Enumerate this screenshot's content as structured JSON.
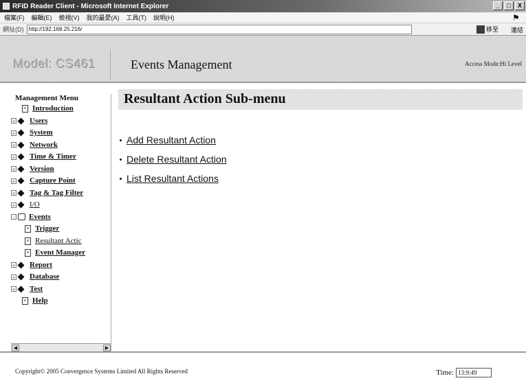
{
  "window": {
    "title": "RFID Reader Client - Microsoft Internet Explorer",
    "controls": [
      "_",
      "□",
      "X"
    ]
  },
  "menubar": {
    "items": [
      "檔案(F)",
      "編輯(E)",
      "檢視(V)",
      "我的最愛(A)",
      "工具(T)",
      "說明(H)"
    ]
  },
  "addressbar": {
    "label": "網址(D)",
    "url": "http://192.168.25.216/",
    "go_label": "移至",
    "links_label": "連結"
  },
  "header": {
    "model": "Model: CS461",
    "section_title": "Events Management",
    "access_mode": "Access Mode:Hi Level"
  },
  "nav": {
    "title": "Management Menu",
    "items": [
      {
        "label": "Introduction"
      },
      {
        "label": "Users"
      },
      {
        "label": "System"
      },
      {
        "label": "Network"
      },
      {
        "label": "Time & Timer"
      },
      {
        "label": "Version"
      },
      {
        "label": "Capture Point"
      },
      {
        "label": "Tag & Tag Filter"
      },
      {
        "label": "I/O"
      },
      {
        "label": "Events"
      },
      {
        "label": "Trigger"
      },
      {
        "label": "Resultant Actic"
      },
      {
        "label": "Event Manager"
      },
      {
        "label": "Report"
      },
      {
        "label": "Database"
      },
      {
        "label": "Test"
      },
      {
        "label": "Help"
      }
    ]
  },
  "main": {
    "heading": "Resultant Action Sub-menu",
    "links": [
      {
        "label": "Add Resultant Action"
      },
      {
        "label": "Delete Resultant Action"
      },
      {
        "label": "List Resultant Actions"
      }
    ]
  },
  "footer": {
    "copyright": "Copyright© 2005 Convergence Systems Limited All Rights Reserved",
    "time_label": "Time:",
    "time_value": "13:9:49"
  }
}
